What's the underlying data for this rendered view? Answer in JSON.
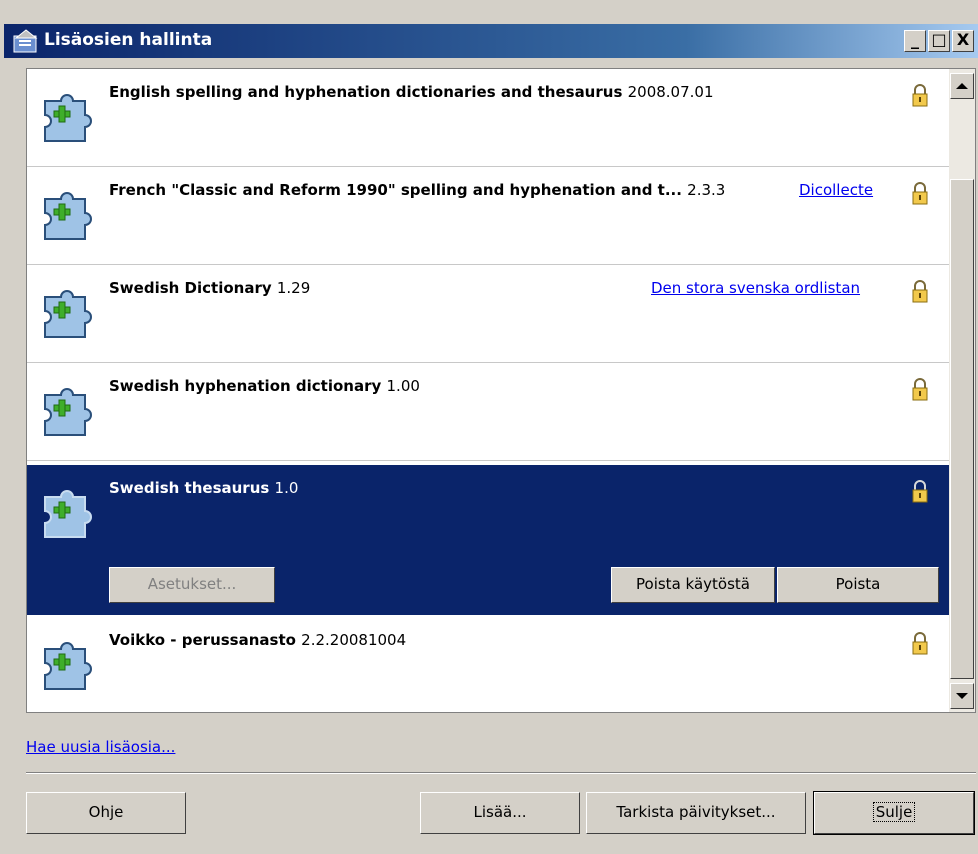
{
  "window": {
    "title": "Lisäosien hallinta",
    "controls": {
      "minimize": "_",
      "maximize": "□",
      "close": "X"
    }
  },
  "extensions": [
    {
      "name": "English spelling and hyphenation dictionaries and thesaurus",
      "version": "2008.07.01",
      "link": "",
      "icon": "puzzle-icon",
      "lock": "lock-icon"
    },
    {
      "name": "French \"Classic and Reform 1990\" spelling and hyphenation and t...",
      "version": "2.3.3",
      "link": "Dicollecte",
      "icon": "puzzle-icon",
      "lock": "lock-icon"
    },
    {
      "name": "Swedish Dictionary",
      "version": "1.29",
      "link": "Den stora svenska ordlistan",
      "icon": "puzzle-icon",
      "lock": "lock-icon"
    },
    {
      "name": "Swedish hyphenation dictionary",
      "version": "1.00",
      "link": "",
      "icon": "puzzle-icon",
      "lock": "lock-icon"
    },
    {
      "name": "Swedish thesaurus",
      "version": "1.0",
      "link": "",
      "icon": "puzzle-icon",
      "lock": "lock-icon",
      "selected": true
    },
    {
      "name": "Voikko - perussanasto",
      "version": "2.2.20081004",
      "link": "",
      "icon": "puzzle-icon",
      "lock": "lock-icon"
    }
  ],
  "selected_actions": {
    "options": "Asetukset...",
    "disable": "Poista käytöstä",
    "remove": "Poista"
  },
  "get_more": "Hae uusia lisäosia...",
  "buttons": {
    "help": "Ohje",
    "add": "Lisää...",
    "check_updates": "Tarkista päivitykset...",
    "close": "Sulje"
  },
  "colors": {
    "selection": "#0a246a",
    "link": "#0000ee",
    "face": "#d4d0c8"
  }
}
